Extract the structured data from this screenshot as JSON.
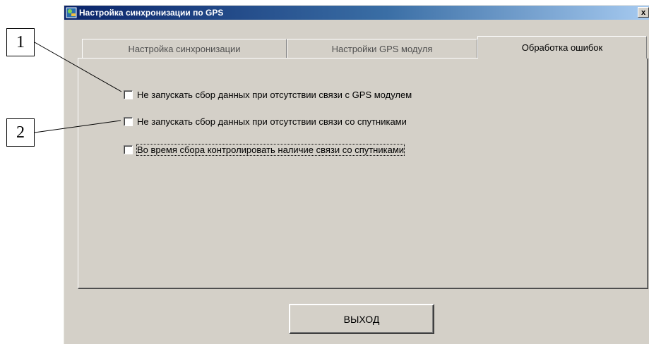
{
  "callouts": [
    "1",
    "2"
  ],
  "window": {
    "title": "Настройка синхронизации по GPS",
    "close_label": "x"
  },
  "tabs": [
    {
      "label": "Настройка синхронизации",
      "active": false
    },
    {
      "label": "Настройки GPS модуля",
      "active": false
    },
    {
      "label": "Обработка ошибок",
      "active": true
    }
  ],
  "options": [
    {
      "label": "Не запускать сбор данных при отсутствии связи с GPS модулем",
      "checked": false
    },
    {
      "label": "Не запускать сбор данных при отсутствии связи со спутниками",
      "checked": false
    },
    {
      "label": "Во время сбора контролировать наличие связи со спутниками",
      "checked": false,
      "focused": true
    }
  ],
  "exit_button": {
    "label": "ВЫХОД"
  },
  "icons": {
    "app": "gps-app-icon",
    "close": "close-icon"
  }
}
